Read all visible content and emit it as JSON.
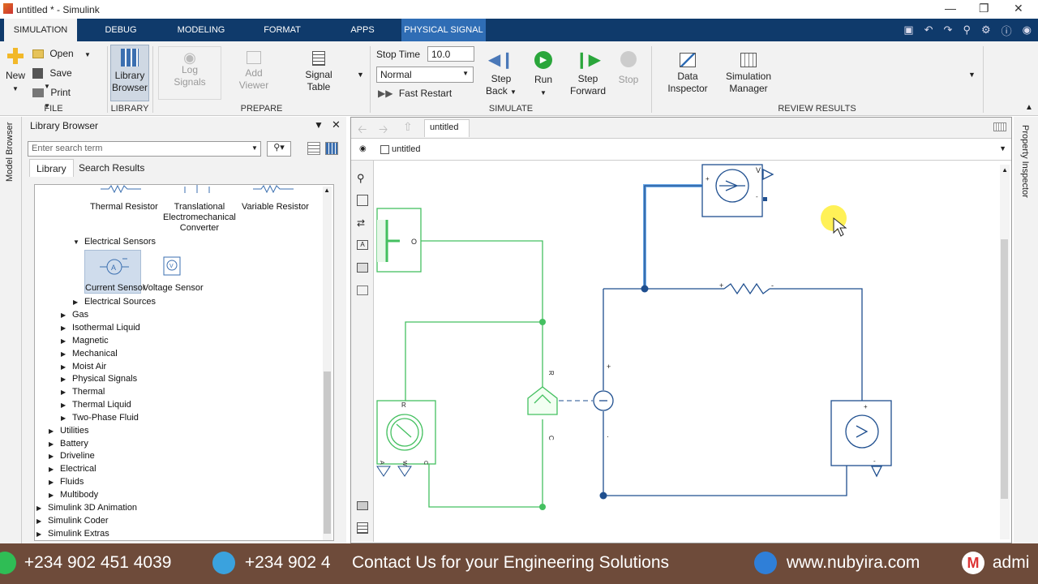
{
  "window": {
    "title": "untitled * - Simulink"
  },
  "ribbon_tabs": [
    "SIMULATION",
    "DEBUG",
    "MODELING",
    "FORMAT",
    "APPS",
    "PHYSICAL SIGNAL"
  ],
  "file": {
    "new": "New",
    "open": "Open",
    "save": "Save",
    "print": "Print",
    "group": "FILE"
  },
  "library": {
    "button_line1": "Library",
    "button_line2": "Browser",
    "group": "LIBRARY"
  },
  "prepare": {
    "log_l1": "Log",
    "log_l2": "Signals",
    "add_l1": "Add",
    "add_l2": "Viewer",
    "sig_l1": "Signal",
    "sig_l2": "Table",
    "group": "PREPARE"
  },
  "simulate": {
    "stop_time_label": "Stop Time",
    "stop_time_value": "10.0",
    "mode": "Normal",
    "fast_restart": "Fast Restart",
    "stepback_l1": "Step",
    "stepback_l2": "Back",
    "run": "Run",
    "stepfwd_l1": "Step",
    "stepfwd_l2": "Forward",
    "stop": "Stop",
    "group": "SIMULATE"
  },
  "review": {
    "data_l1": "Data",
    "data_l2": "Inspector",
    "simman_l1": "Simulation",
    "simman_l2": "Manager",
    "group": "REVIEW RESULTS"
  },
  "left_strip_label": "Model Browser",
  "right_strip_label": "Property Inspector",
  "library_browser": {
    "title": "Library Browser",
    "search_placeholder": "Enter search term",
    "tabs": [
      "Library",
      "Search Results"
    ],
    "blocks_top": [
      "Thermal Resistor",
      "Translational\nElectromechanical\nConverter",
      "Variable Resistor"
    ],
    "electrical_sensors": "Electrical Sensors",
    "sensors": [
      "Current Sensor",
      "Voltage Sensor"
    ],
    "tree": [
      "Electrical Sources",
      "Gas",
      "Isothermal Liquid",
      "Magnetic",
      "Mechanical",
      "Moist Air",
      "Physical Signals",
      "Thermal",
      "Thermal Liquid",
      "Two-Phase Fluid",
      "Utilities",
      "Battery",
      "Driveline",
      "Electrical",
      "Fluids",
      "Multibody",
      "Simulink 3D Animation",
      "Simulink Coder",
      "Simulink Extras"
    ]
  },
  "canvas": {
    "tab": "untitled",
    "address": "untitled",
    "labels": {
      "v": "V",
      "o": "O",
      "r": "R",
      "c": "C",
      "plus": "+",
      "minus": "-",
      "dot": "·",
      "a": "A",
      "w": "W",
      "c2": "C"
    }
  },
  "banner": {
    "phone1": "+234 902 451 4039",
    "phone2": "+234 902 4",
    "slogan": "Contact Us for your Engineering Solutions",
    "web": "www.nubyira.com",
    "mail": "admi"
  },
  "colors": {
    "tabbar": "#0f3a6b",
    "physical_tab": "#2f6db5",
    "green_wire": "#44c060",
    "blue_wire": "#1f4f8f",
    "highlight_wire": "#3a8ce0",
    "banner": "#6e4b3a"
  }
}
